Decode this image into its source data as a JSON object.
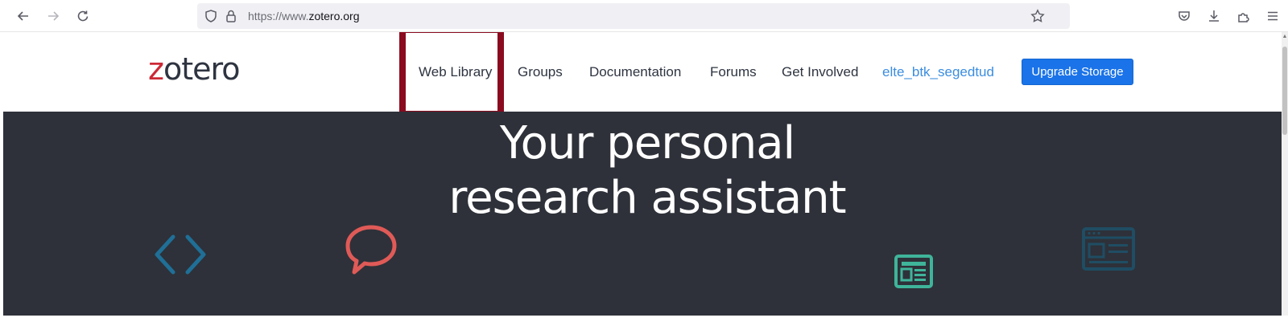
{
  "browser": {
    "url_prefix": "https://www.",
    "url_domain": "zotero.org",
    "icons": {
      "back": "arrow-left-icon",
      "forward": "arrow-right-icon",
      "reload": "reload-icon",
      "shield": "shield-icon",
      "lock": "lock-icon",
      "bookmark": "star-icon",
      "pocket": "pocket-icon",
      "downloads": "download-icon",
      "extensions": "puzzle-icon",
      "menu": "hamburger-menu-icon"
    }
  },
  "site": {
    "logo_first": "z",
    "logo_rest": "otero",
    "nav": [
      {
        "label": "Web Library"
      },
      {
        "label": "Groups"
      },
      {
        "label": "Documentation"
      },
      {
        "label": "Forums"
      },
      {
        "label": "Get Involved"
      }
    ],
    "user": "elte_btk_segedtud",
    "upgrade_label": "Upgrade Storage",
    "highlight_color": "#8a0b1f",
    "accent": "#1a73e8",
    "logo_accent": "#cc2936"
  },
  "hero": {
    "line1": "Your personal",
    "line2": "research assistant",
    "background": "#2e3139",
    "icons": [
      "code-brackets-icon",
      "speech-bubble-icon",
      "newspaper-icon",
      "webpage-icon"
    ]
  }
}
